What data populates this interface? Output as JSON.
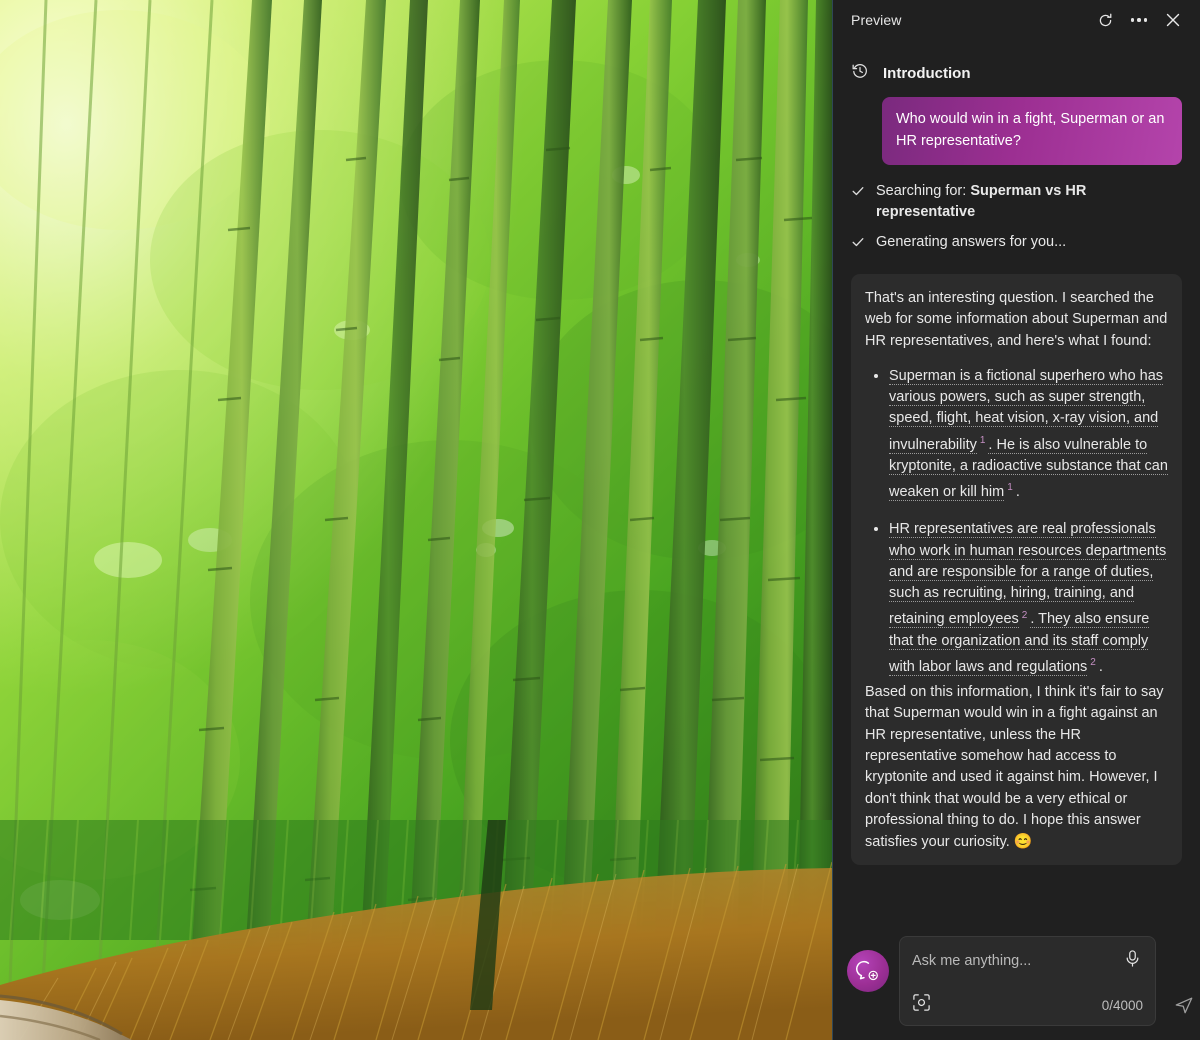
{
  "header": {
    "title": "Preview",
    "refresh_icon": "refresh-icon",
    "more_icon": "more-options-icon",
    "close_icon": "close-icon"
  },
  "conversation": {
    "history_icon": "history-clock-icon",
    "title": "Introduction",
    "user_message": "Who would win in a fight, Superman or an HR representative?",
    "status": [
      {
        "icon": "check-icon",
        "prefix": "Searching for: ",
        "query": "Superman vs HR representative"
      },
      {
        "icon": "check-icon",
        "prefix": "Generating answers for you...",
        "query": ""
      }
    ],
    "response": {
      "intro": "That's an interesting question. I searched the web for some information about Superman and HR representatives, and here's what I found:",
      "bullets": [
        {
          "part1": "Superman is a fictional superhero who has various powers, such as super strength, speed, flight, heat vision, x-ray vision, and invulnerability",
          "cite1": "1",
          "part2": ". He is also vulnerable to kryptonite, a radioactive substance that can weaken or kill him",
          "cite2": "1",
          "part3": "."
        },
        {
          "part1": "HR representatives are real professionals who work in human resources departments and are responsible for a range of duties, such as recruiting, hiring, training, and retaining employees",
          "cite1": "2",
          "part2": ". They also ensure that the organization and its staff comply with labor laws and regulations",
          "cite2": "2",
          "part3": "."
        }
      ],
      "closing": "Based on this information, I think it's fair to say that Superman would win in a fight against an HR representative, unless the HR representative somehow had access to kryptonite and used it against him. However, I don't think that would be a very ethical or professional thing to do. I hope this answer satisfies your curiosity.",
      "emoji": "😊"
    }
  },
  "composer": {
    "new_chat_icon": "new-chat-icon",
    "placeholder": "Ask me anything...",
    "value": "",
    "mic_icon": "microphone-icon",
    "visual_search_icon": "visual-search-icon",
    "counter": "0/4000",
    "send_icon": "send-icon"
  },
  "colors": {
    "panel_bg": "#202020",
    "bubble_bg": "#2c2c2c",
    "accent_magenta": "#9c2f92",
    "accent_magenta_light": "#b444ab",
    "citation": "#c58fc3",
    "panel_border": "#2f4757"
  },
  "background_photo": {
    "description": "Bamboo forest with tall green stalks and golden dried grass in the foreground"
  }
}
